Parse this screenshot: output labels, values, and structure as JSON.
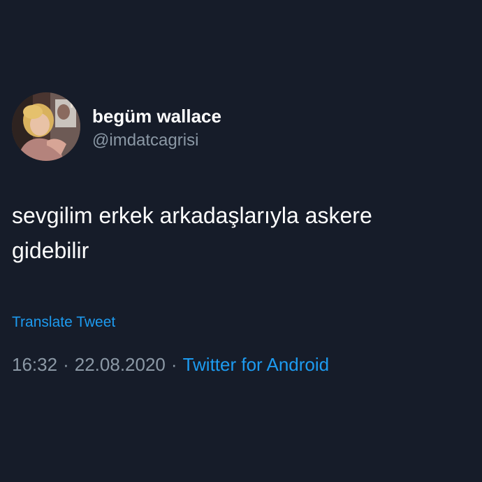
{
  "tweet": {
    "author": {
      "display_name": "begüm wallace",
      "handle": "@imdatcagrisi",
      "avatar_icon": "profile-photo"
    },
    "text_line_1": "sevgilim erkek arkadaşlarıyla askere",
    "text_line_2": "gidebilir",
    "translate_label": "Translate Tweet",
    "time": "16:32",
    "separator": "·",
    "date": "22.08.2020",
    "source": "Twitter for Android"
  },
  "colors": {
    "background": "#161c29",
    "primary_text": "#ffffff",
    "secondary_text": "#8b98a5",
    "link": "#1d9bf0"
  }
}
